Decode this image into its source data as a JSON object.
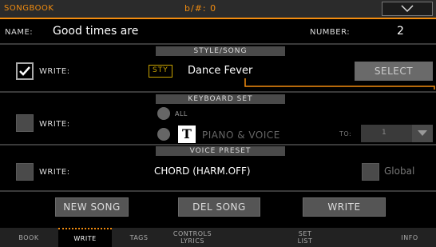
{
  "app_title": "SONGBOOK",
  "top_center": "b/#: 0",
  "name_label": "NAME:",
  "name_value": "Good times are",
  "number_label": "NUMBER:",
  "number_value": "2",
  "style_song": {
    "header": "STYLE/SONG",
    "write_label": "WRITE:",
    "write_checked": true,
    "badge": "STY",
    "value": "Dance Fever",
    "select_label": "SELECT"
  },
  "keyboard_set": {
    "header": "KEYBOARD SET",
    "write_label": "WRITE:",
    "write_checked": false,
    "option_all": "ALL",
    "option_piano": "PIANO & VOICE",
    "piano_icon": "T",
    "to_label": "TO:",
    "to_value": "1"
  },
  "voice_preset": {
    "header": "VOICE PRESET",
    "write_label": "WRITE:",
    "write_checked": false,
    "value": "CHORD (HARM.OFF)",
    "global_label": "Global"
  },
  "buttons": {
    "new_song": "NEW SONG",
    "del_song": "DEL SONG",
    "write": "WRITE"
  },
  "tabs": [
    "BOOK",
    "WRITE",
    "TAGS",
    "CONTROLS\nLYRICS",
    "SET\nLIST",
    "INFO"
  ],
  "active_tab": "WRITE",
  "colors": {
    "accent": "#f28c0f",
    "badge": "#c8a200"
  }
}
